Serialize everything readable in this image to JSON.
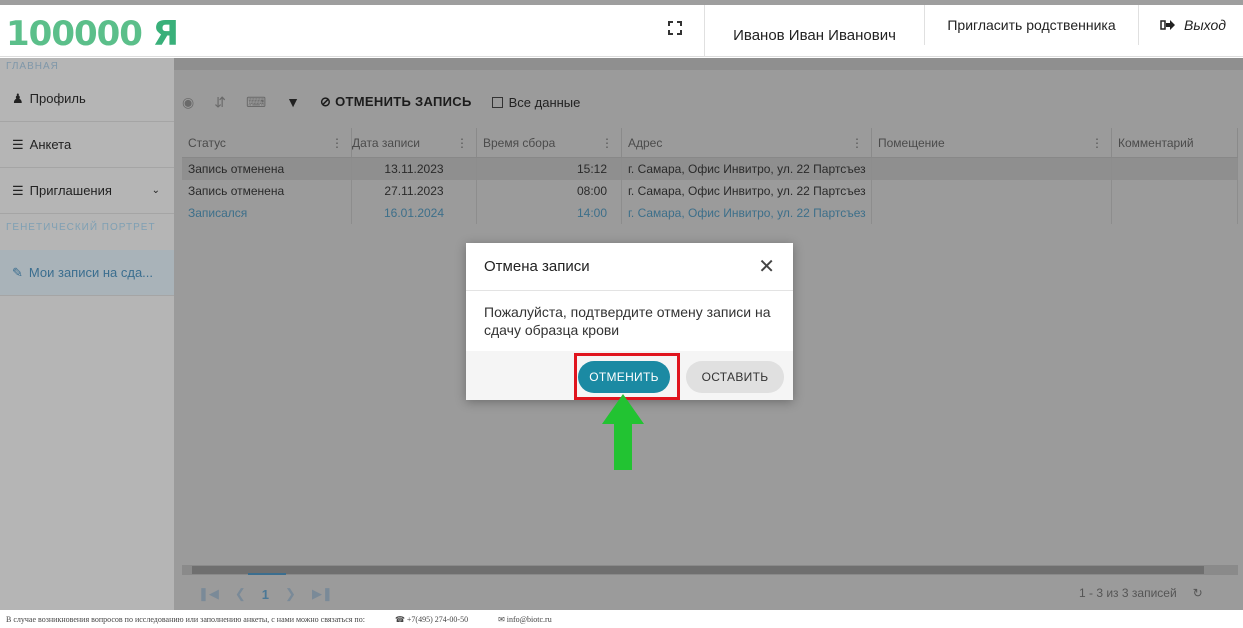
{
  "header": {
    "logo_text": "100000",
    "logo_ya": "Я",
    "user_name": "Иванов Иван Иванович",
    "invite_label": "Пригласить родственника",
    "exit_label": "Выход"
  },
  "sidebar": {
    "section_main": "ГЛАВНАЯ",
    "items": [
      {
        "label": "Профиль",
        "icon": "user-icon"
      },
      {
        "label": "Анкета",
        "icon": "list-icon"
      },
      {
        "label": "Приглашения",
        "icon": "list-icon"
      }
    ],
    "section_genetic": "ГЕНЕТИЧЕСКИЙ ПОРТРЕТ",
    "active_item": "Мои записи на сда..."
  },
  "toolbar": {
    "cancel_record": "ОТМЕНИТЬ ЗАПИСЬ",
    "all_data": "Все данные"
  },
  "table": {
    "columns": [
      "Статус",
      "Дата записи",
      "Время сбора",
      "Адрес",
      "Помещение",
      "Комментарий"
    ],
    "rows": [
      [
        "Запись отменена",
        "13.11.2023",
        "15:12",
        "г. Самара, Офис Инвитро, ул. 22 Партсъез",
        "",
        ""
      ],
      [
        "Запись отменена",
        "27.11.2023",
        "08:00",
        "г. Самара, Офис Инвитро, ул. 22 Партсъез",
        "",
        ""
      ],
      [
        "Записался",
        "16.01.2024",
        "14:00",
        "г. Самара, Офис Инвитро, ул. 22 Партсъез",
        "",
        ""
      ]
    ]
  },
  "pager": {
    "current_page": "1",
    "records": "1 - 3 из 3 записей"
  },
  "footer": {
    "text": "В случае возникновения вопросов по исследованию или заполнению анкеты, с нами можно связаться по:",
    "phone": "+7(495) 274-00-50",
    "email": "info@biotc.ru"
  },
  "modal": {
    "title": "Отмена записи",
    "message": "Пожалуйста, подтвердите отмену записи на сдачу образца крови",
    "confirm_label": "ОТМЕНИТЬ",
    "keep_label": "ОСТАВИТЬ"
  },
  "colors": {
    "accent": "#1b8aa3",
    "highlight": "#e0151e",
    "arrow": "#22c332"
  }
}
